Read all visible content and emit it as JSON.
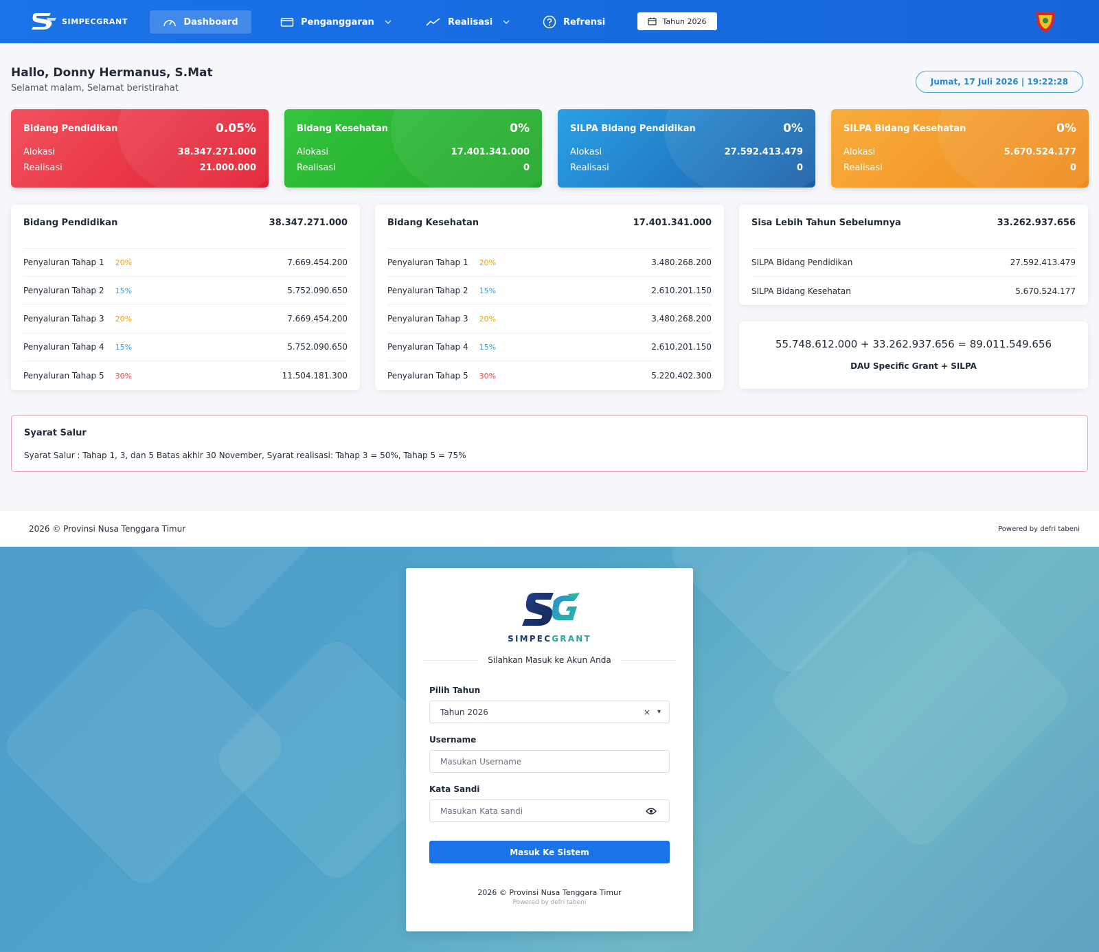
{
  "nav": {
    "brand": "SIMPECGRANT",
    "items": [
      {
        "label": "Dashboard",
        "icon": "gauge-icon",
        "active": true
      },
      {
        "label": "Penganggaran",
        "icon": "wallet-icon",
        "has_dropdown": true
      },
      {
        "label": "Realisasi",
        "icon": "trend-icon",
        "has_dropdown": true
      },
      {
        "label": "Refrensi",
        "icon": "help-circle-icon"
      }
    ],
    "year_label": "Tahun 2026"
  },
  "header": {
    "greeting": "Hallo, Donny Hermanus, S.Mat",
    "subgreeting": "Selamat malam, Selamat beristirahat",
    "datetime": "Jumat, 17 Juli 2026 | 19:22:28"
  },
  "stats": [
    {
      "title": "Bidang Pendidikan",
      "percent": "0.05%",
      "alokasi_label": "Alokasi",
      "alokasi": "38.347.271.000",
      "realisasi_label": "Realisasi",
      "realisasi": "21.000.000",
      "color": "#e8283a"
    },
    {
      "title": "Bidang Kesehatan",
      "percent": "0%",
      "alokasi_label": "Alokasi",
      "alokasi": "17.401.341.000",
      "realisasi_label": "Realisasi",
      "realisasi": "0",
      "color": "#22b52b"
    },
    {
      "title": "SILPA Bidang Pendidikan",
      "percent": "0%",
      "alokasi_label": "Alokasi",
      "alokasi": "27.592.413.479",
      "realisasi_label": "Realisasi",
      "realisasi": "0",
      "color": "#1e7ec4"
    },
    {
      "title": "SILPA Bidang Kesehatan",
      "percent": "0%",
      "alokasi_label": "Alokasi",
      "alokasi": "5.670.524.177",
      "realisasi_label": "Realisasi",
      "realisasi": "0",
      "color": "#f39a25"
    }
  ],
  "pendidikan": {
    "title": "Bidang Pendidikan",
    "total": "38.347.271.000",
    "rows": [
      {
        "label": "Penyaluran Tahap 1",
        "pct": "20%",
        "value": "7.669.454.200"
      },
      {
        "label": "Penyaluran Tahap 2",
        "pct": "15%",
        "value": "5.752.090.650"
      },
      {
        "label": "Penyaluran Tahap 3",
        "pct": "20%",
        "value": "7.669.454.200"
      },
      {
        "label": "Penyaluran Tahap 4",
        "pct": "15%",
        "value": "5.752.090.650"
      },
      {
        "label": "Penyaluran Tahap 5",
        "pct": "30%",
        "value": "11.504.181.300"
      }
    ]
  },
  "kesehatan": {
    "title": "Bidang Kesehatan",
    "total": "17.401.341.000",
    "rows": [
      {
        "label": "Penyaluran Tahap 1",
        "pct": "20%",
        "value": "3.480.268.200"
      },
      {
        "label": "Penyaluran Tahap 2",
        "pct": "15%",
        "value": "2.610.201.150"
      },
      {
        "label": "Penyaluran Tahap 3",
        "pct": "20%",
        "value": "3.480.268.200"
      },
      {
        "label": "Penyaluran Tahap 4",
        "pct": "15%",
        "value": "2.610.201.150"
      },
      {
        "label": "Penyaluran Tahap 5",
        "pct": "30%",
        "value": "5.220.402.300"
      }
    ]
  },
  "silpa": {
    "title": "Sisa Lebih Tahun Sebelumnya",
    "total": "33.262.937.656",
    "rows": [
      {
        "label": "SILPA Bidang Pendidikan",
        "value": "27.592.413.479"
      },
      {
        "label": "SILPA Bidang Kesehatan",
        "value": "5.670.524.177"
      }
    ]
  },
  "summary": {
    "equation": "55.748.612.000 + 33.262.937.656 = 89.011.549.656",
    "caption": "DAU Specific Grant + SILPA"
  },
  "syarat": {
    "title": "Syarat Salur",
    "text": "Syarat Salur : Tahap 1, 3, dan 5 Batas akhir 30 November, Syarat realisasi: Tahap 3 = 50%, Tahap 5 = 75%"
  },
  "footer": {
    "left": "2026 © Provinsi Nusa Tenggara Timur",
    "right": "Powered by defri tabeni"
  },
  "login": {
    "brand_a": "SIMPEC",
    "brand_b": "GRANT",
    "subtitle": "Silahkan Masuk ke Akun Anda",
    "year_label": "Pilih Tahun",
    "year_value": "Tahun 2026",
    "username_label": "Username",
    "username_placeholder": "Masukan Username",
    "password_label": "Kata Sandi",
    "password_placeholder": "Masukan Kata sandi",
    "submit": "Masuk Ke Sistem",
    "footer": "2026 © Provinsi Nusa Tenggara Timur",
    "powered": "Powered by defri tabeni",
    "clear_symbol": "×",
    "caret_symbol": "▾"
  },
  "colors": {
    "nav": "#1a73e8",
    "accent": "#1a73e8",
    "pct_20": "#f59e0b",
    "pct_15": "#3b9bdc",
    "pct_30": "#ef4444"
  }
}
